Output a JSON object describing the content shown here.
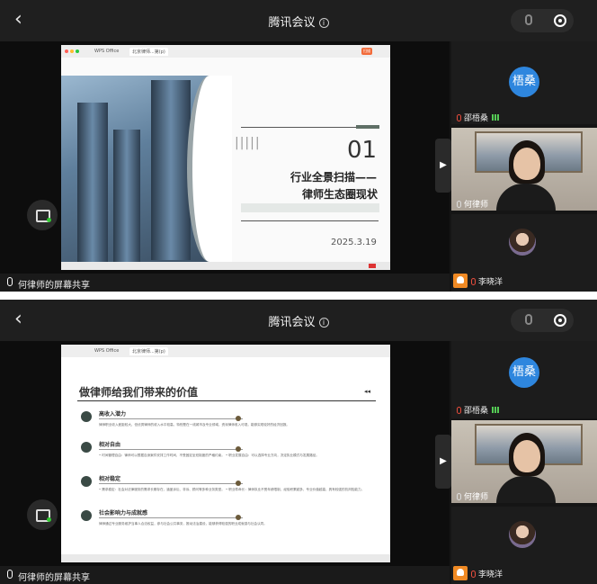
{
  "meeting": {
    "title": "腾讯会议"
  },
  "screen_share": {
    "label": "何律师的屏幕共享"
  },
  "browser": {
    "tab_wps": "WPS Office",
    "tab_doc": "北京律师...第(p)",
    "badge": "扫描"
  },
  "participants": {
    "p1": {
      "avatar_text": "梧桑",
      "name": "邵梧桑"
    },
    "p2": {
      "name": "何律师"
    },
    "p3": {
      "name": "李晓洋"
    }
  },
  "slide1": {
    "number": "01",
    "title_line1": "行业全景扫描——",
    "title_line2": "律师生态圈现状",
    "date": "2025.3.19",
    "bars": "|||||"
  },
  "slide2": {
    "heading": "做律师给我们带来的价值",
    "arrows": "◂◂",
    "items": [
      {
        "title": "高收入潜力",
        "body": "律师职业收入差距较大，但优秀律师的收入水平较高，特别是在一线城市及专业领域，资深律师收入可观，能够实现较好的经济回报。"
      },
      {
        "title": "相对自由",
        "body": "• 时间管理自由：律师可以根据自身案件安排工作时间，不受固定坐班制度的严格约束。  • 职业发展自由：可以选择专业方向，决定执业模式与发展路径。"
      },
      {
        "title": "相对稳定",
        "body": "• 需求稳定：社会对法律服务的需求长期存在，涵盖诉讼、非诉、顾问等多种业务类型。  • 职业寿命长：律师执业不受年龄限制，经验积累越多，专业价值越高，具有较强的抗风险能力。"
      },
      {
        "title": "社会影响力与成就感",
        "body": "律师通过专业服务维护当事人合法权益，参与社会公共事务，推动法治建设，能够获得较强的职业成就感与社会认同。"
      }
    ]
  }
}
